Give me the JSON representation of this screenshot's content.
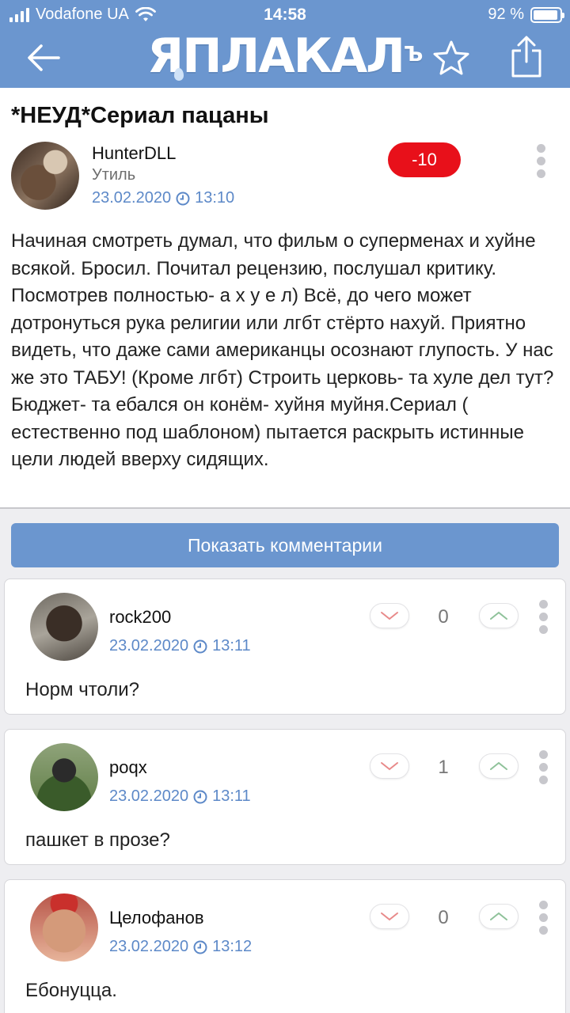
{
  "status_bar": {
    "carrier": "Vodafone UA",
    "time": "14:58",
    "battery": "92 %"
  },
  "header": {
    "logo": "ЯПЛАКАЛ",
    "logo_suffix": "Ъ"
  },
  "post": {
    "title": "*НЕУД*Сериал пацаны",
    "author": "HunterDLL",
    "rank": "Утиль",
    "date": "23.02.2020",
    "time": "13:10",
    "rating": "-10",
    "body": "Начиная смотреть думал, что фильм о суперменах и хуйне всякой. Бросил. Почитал рецензию, послушал критику. Посмотрев полностью- а х у е л)   Всё, до чего может дотронуться рука религии или лгбт стёрто нахуй. Приятно видеть, что даже сами американцы осознают глупость. У нас же это ТАБУ! (Кроме лгбт) Строить церковь- та хуле дел тут? Бюджет- та ебался он конём- хуйня муйня.Сериал ( естественно под шаблоном) пытается раскрыть истинные цели людей вверху сидящих."
  },
  "show_comments_label": "Показать комментарии",
  "comments": [
    {
      "author": "rock200",
      "date": "23.02.2020",
      "time": "13:11",
      "text": "Норм чтоли?",
      "score": "0"
    },
    {
      "author": "poqx",
      "date": "23.02.2020",
      "time": "13:11",
      "text": "пашкет в прозе?",
      "score": "1"
    },
    {
      "author": "Целофанов",
      "date": "23.02.2020",
      "time": "13:12",
      "text": "Ебонуцца.",
      "score": "0"
    }
  ],
  "colors": {
    "brand": "#6b96cf",
    "rating_negative": "#e8101a",
    "date": "#5d89c8",
    "upvote": "#8fc29a",
    "downvote": "#e88a8a"
  },
  "icons": [
    "back-arrow-icon",
    "star-icon",
    "share-icon",
    "clock-icon",
    "kebab-menu-icon",
    "downvote-chevron-icon",
    "upvote-chevron-icon"
  ]
}
